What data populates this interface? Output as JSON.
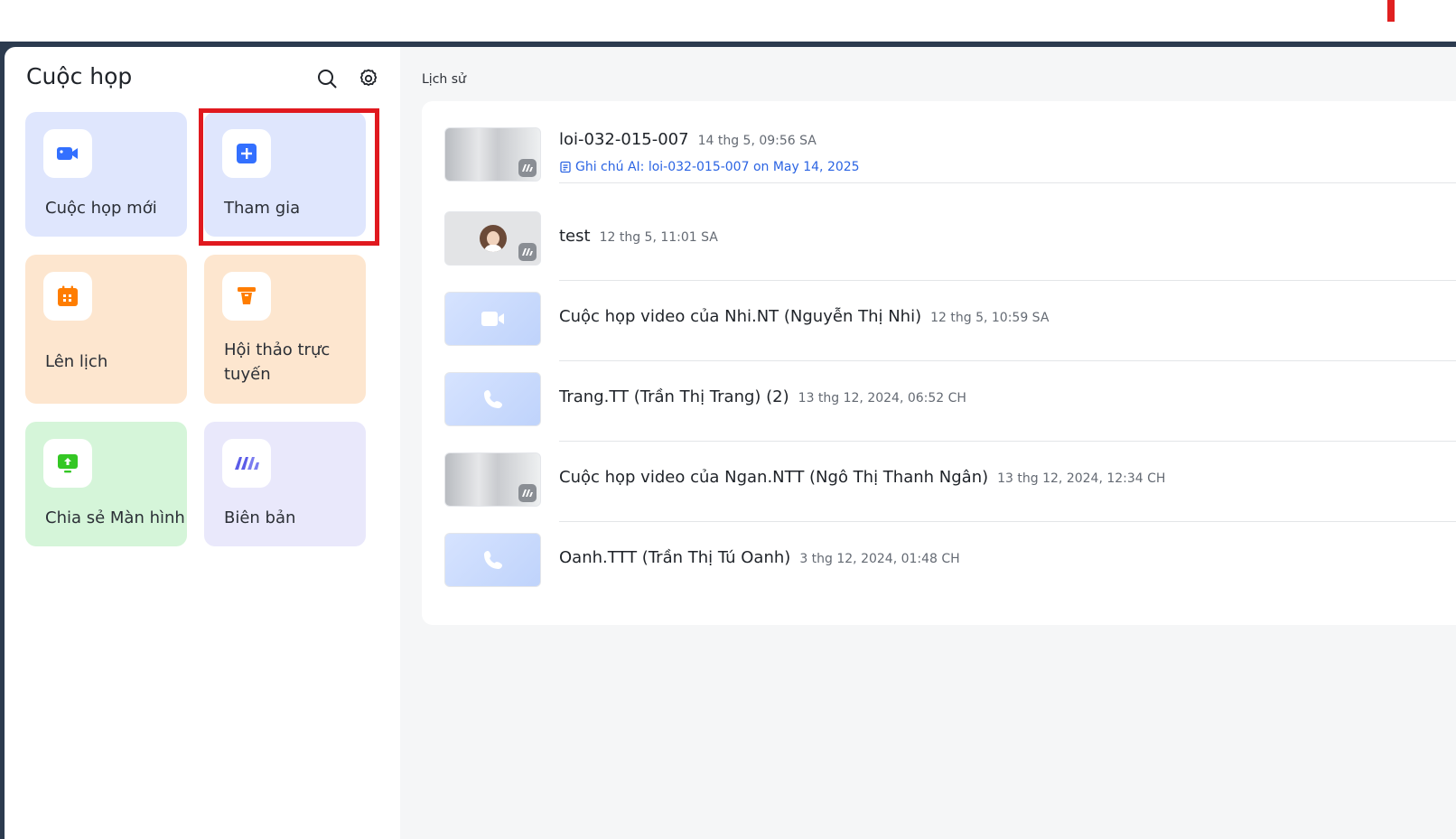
{
  "sidebar": {
    "title": "Cuộc họp",
    "tiles": [
      {
        "label": "Cuộc họp mới",
        "icon": "video-camera-icon"
      },
      {
        "label": "Tham gia",
        "icon": "plus-square-icon"
      },
      {
        "label": "Lên lịch",
        "icon": "calendar-icon"
      },
      {
        "label": "Hội thảo trực tuyến",
        "icon": "webinar-podium-icon"
      },
      {
        "label": "Chia sẻ Màn hình",
        "icon": "share-screen-icon"
      },
      {
        "label": "Biên bản",
        "icon": "minutes-icon"
      }
    ]
  },
  "main": {
    "history_label": "Lịch sử",
    "meetings": [
      {
        "title": "loi-032-015-007",
        "time": "14 thg 5, 09:56 SA",
        "note": "Ghi chú AI: loi-032-015-007 on May 14, 2025"
      },
      {
        "title": "test",
        "time": "12 thg 5, 11:01 SA"
      },
      {
        "title": "Cuộc họp video của Nhi.NT (Nguyễn Thị Nhi)",
        "time": "12 thg 5, 10:59 SA"
      },
      {
        "title": "Trang.TT (Trần Thị Trang) (2)",
        "time": "13 thg 12, 2024, 06:52 CH"
      },
      {
        "title": "Cuộc họp video của Ngan.NTT (Ngô Thị Thanh Ngân)",
        "time": "13 thg 12, 2024, 12:34 CH"
      },
      {
        "title": "Oanh.TTT (Trần Thị Tú Oanh)",
        "time": "3 thg 12, 2024, 01:48 CH"
      }
    ]
  },
  "colors": {
    "accent_blue": "#2b64e3",
    "highlight_red": "#e0191f",
    "tile_blue": "#dfe6fd",
    "tile_orange": "#fde6cf",
    "tile_green": "#d5f5d9",
    "tile_purple": "#e9e8fb"
  }
}
